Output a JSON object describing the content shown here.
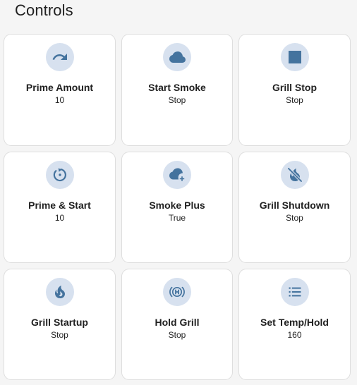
{
  "header": {
    "title": "Controls"
  },
  "cards": [
    {
      "name": "Prime Amount",
      "state": "10",
      "icon": "redo-arrow-icon"
    },
    {
      "name": "Start Smoke",
      "state": "Stop",
      "icon": "cloud-icon"
    },
    {
      "name": "Grill Stop",
      "state": "Stop",
      "icon": "stop-square-icon"
    },
    {
      "name": "Prime & Start",
      "state": "10",
      "icon": "restart-icon"
    },
    {
      "name": "Smoke Plus",
      "state": "True",
      "icon": "cloud-plus-icon"
    },
    {
      "name": "Grill Shutdown",
      "state": "Stop",
      "icon": "fire-off-icon"
    },
    {
      "name": "Grill Startup",
      "state": "Stop",
      "icon": "fire-icon"
    },
    {
      "name": "Hold Grill",
      "state": "Stop",
      "icon": "hold-h-icon"
    },
    {
      "name": "Set Temp/Hold",
      "state": "160",
      "icon": "list-icon"
    }
  ],
  "colors": {
    "accent": "#44739e",
    "icon_bg": "#d7e1ef",
    "card_bg": "#ffffff",
    "page_bg": "#f5f5f5",
    "text": "#212121"
  }
}
